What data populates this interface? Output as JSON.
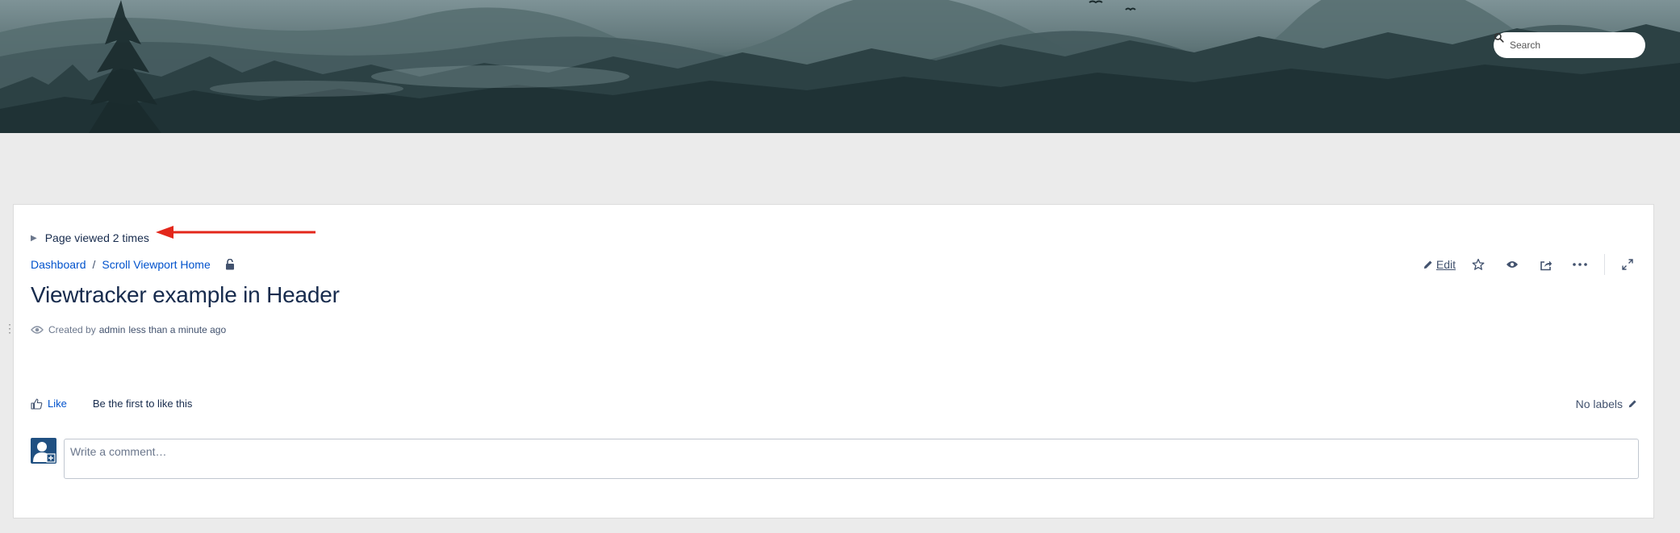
{
  "header": {
    "search": {
      "placeholder": "Search"
    }
  },
  "page": {
    "viewed_text": "Page viewed 2 times",
    "breadcrumb": [
      {
        "label": "Dashboard"
      },
      {
        "label": "Scroll Viewport Home"
      }
    ],
    "breadcrumb_separator": "/",
    "title": "Viewtracker example in Header",
    "byline": {
      "created_by": "Created by",
      "author": "admin",
      "when": "less than a minute ago"
    }
  },
  "toolbar": {
    "edit_label": "Edit",
    "icons": [
      "pencil-icon",
      "star-icon",
      "eye-icon",
      "share-icon",
      "more-icon",
      "fullscreen-icon"
    ]
  },
  "footer": {
    "like_label": "Like",
    "first_like": "Be the first to like this",
    "labels_text": "No labels"
  },
  "comment": {
    "placeholder": "Write a comment…"
  },
  "colors": {
    "link": "#0052cc",
    "text": "#172b4d",
    "muted": "#6b778c",
    "annotation_arrow": "#e3271b",
    "avatar_bg": "#205081"
  }
}
